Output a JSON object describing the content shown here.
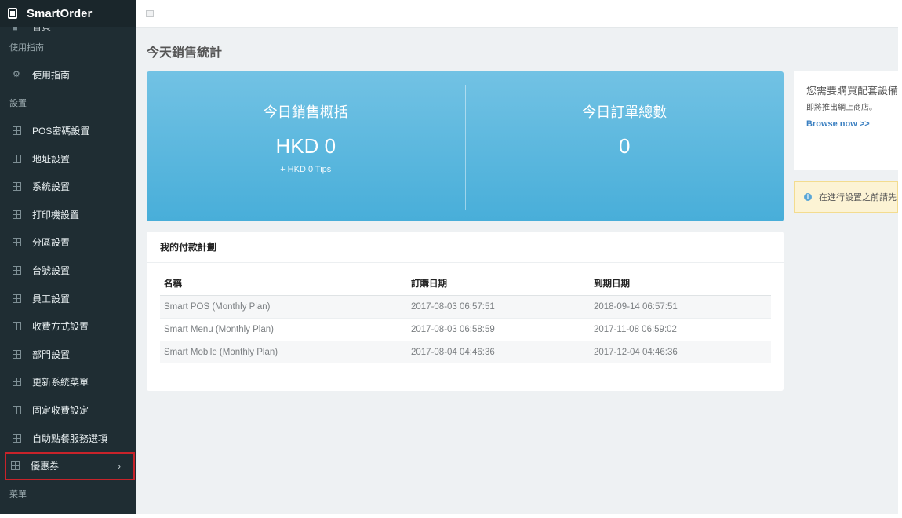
{
  "app": {
    "title": "SmartOrder"
  },
  "sidebar": {
    "partial_item": "首頁",
    "sections": {
      "guide": "使用指南",
      "settings": "設置",
      "menu": "菜單"
    },
    "guide_item": "使用指南",
    "items": [
      {
        "label": "POS密碼設置"
      },
      {
        "label": "地址設置"
      },
      {
        "label": "系統設置"
      },
      {
        "label": "打印機設置"
      },
      {
        "label": "分區設置"
      },
      {
        "label": "台號設置"
      },
      {
        "label": "員工設置"
      },
      {
        "label": "收費方式設置"
      },
      {
        "label": "部門設置"
      },
      {
        "label": "更新系統菜單"
      },
      {
        "label": "固定收費設定"
      },
      {
        "label": "自助點餐服務選項"
      },
      {
        "label": "優惠券",
        "chevron": "›"
      }
    ],
    "colors": {
      "background": "#1f2d33",
      "highlight_border": "#c8232a"
    }
  },
  "main": {
    "title": "今天銷售統計",
    "stats": {
      "sales": {
        "label": "今日銷售概括",
        "value": "HKD 0",
        "sub": "+ HKD 0 Tips"
      },
      "orders": {
        "label": "今日訂單總數",
        "value": "0"
      },
      "colors": {
        "panel": "#58b5de"
      }
    },
    "plans": {
      "title": "我的付款計劃",
      "columns": [
        "名稱",
        "訂購日期",
        "到期日期"
      ],
      "rows": [
        [
          "Smart POS (Monthly Plan)",
          "2017-08-03 06:57:51",
          "2018-09-14 06:57:51"
        ],
        [
          "Smart Menu (Monthly Plan)",
          "2017-08-03 06:58:59",
          "2017-11-08 06:59:02"
        ],
        [
          "Smart Mobile (Monthly Plan)",
          "2017-08-04 04:46:36",
          "2017-12-04 04:46:36"
        ]
      ]
    }
  },
  "promo": {
    "title": "您需要購買配套設備",
    "text": "即將推出網上商店。",
    "link": "Browse now >>",
    "link_color": "#3a7fc1"
  },
  "notice": {
    "text": "在進行設置之前請先",
    "icon": "info-icon"
  }
}
